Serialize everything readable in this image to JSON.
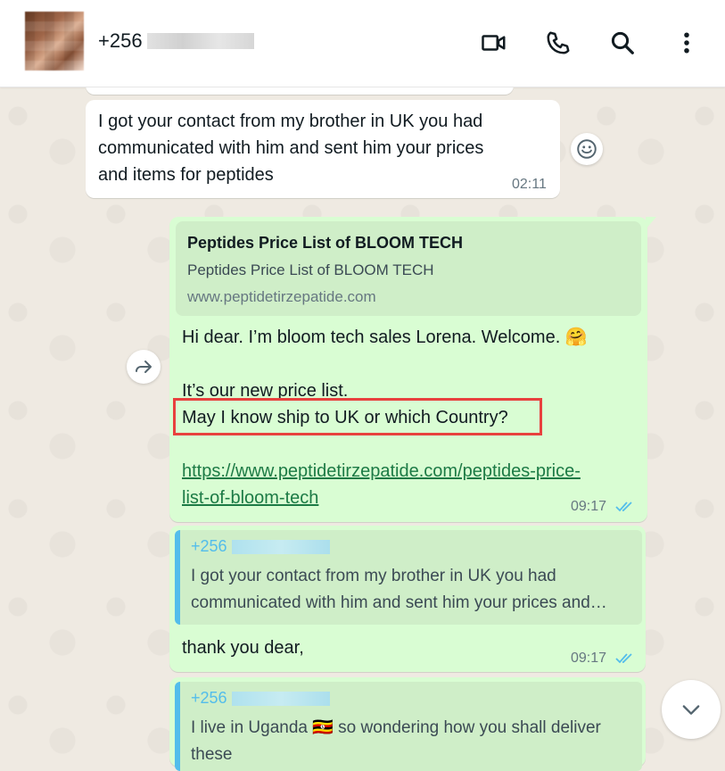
{
  "header": {
    "contact_name": "+256",
    "icons": [
      "video-call-icon",
      "voice-call-icon",
      "search-icon",
      "menu-icon"
    ]
  },
  "messages": [
    {
      "direction": "incoming",
      "lines": [
        "I got your contact from my brother in UK you had",
        "communicated with him and sent him your prices",
        "and items for peptides"
      ],
      "time": "02:11"
    },
    {
      "direction": "outgoing",
      "link_preview": {
        "title": "Peptides Price List of BLOOM TECH",
        "description": "Peptides Price List of BLOOM TECH",
        "domain": "www.peptidetirzepatide.com"
      },
      "greeting": "Hi dear. I’m bloom tech sales Lorena. Welcome. 🤗",
      "line2": "It’s our new price list.",
      "line3": "May I know ship to UK or which Country?",
      "link_line1": "https://www.peptidetirzepatide.com/peptides-price-",
      "link_line2": "list-of-bloom-tech",
      "time": "09:17"
    },
    {
      "direction": "outgoing",
      "quote": {
        "author": "+256",
        "line1": "I got your contact from my brother in UK you had",
        "line2": "communicated with him and sent him your prices and…"
      },
      "text": "thank you dear,",
      "time": "09:17"
    },
    {
      "direction": "outgoing",
      "quote": {
        "author": "+256",
        "line1": "I live in Uganda 🇺🇬 so wondering how you shall deliver",
        "line2": "these"
      }
    }
  ],
  "partial_time_top": "02:11",
  "colors": {
    "incoming_bubble": "#ffffff",
    "outgoing_bubble": "#d9fdd3",
    "quote_bar": "#53bdeb",
    "read_ticks": "#53bdeb",
    "highlight": "#e8413e",
    "link": "#1c7a45"
  }
}
